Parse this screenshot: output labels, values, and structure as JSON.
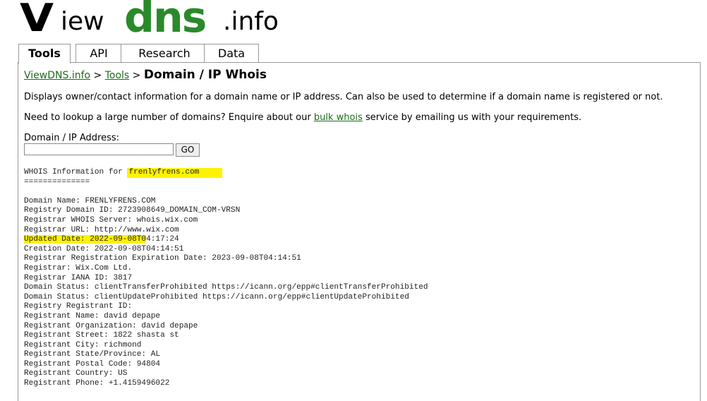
{
  "logo": {
    "v": "V",
    "iew": "iew",
    "dns": "dns",
    "info": ".info"
  },
  "tabs": [
    {
      "label": "Tools",
      "active": true
    },
    {
      "label": "API"
    },
    {
      "label": "Research"
    },
    {
      "label": "Data"
    }
  ],
  "breadcrumb": {
    "home": "ViewDNS.info",
    "sep1": " > ",
    "tools": "Tools",
    "sep2": " > ",
    "title": "Domain / IP Whois"
  },
  "description": {
    "line1": "Displays owner/contact information for a domain name or IP address. Can also be used to determine if a domain name is registered or not.",
    "line2_pre": "Need to lookup a large number of domains? Enquire about our ",
    "line2_link": "bulk whois",
    "line2_post": " service by emailing us with your requirements."
  },
  "form": {
    "label": "Domain / IP Address:",
    "value": "",
    "button": "GO"
  },
  "whois": {
    "header_prefix": "WHOIS Information for ",
    "header_domain": "frenlyfrens.com",
    "underline": "==============",
    "updated_highlight": "Updated Date: 2022-09-08T0",
    "updated_rest": "4:17:24",
    "lines": [
      "Domain Name: FRENLYFRENS.COM",
      "Registry Domain ID: 2723908649_DOMAIN_COM-VRSN",
      "Registrar WHOIS Server: whois.wix.com",
      "Registrar URL: http://www.wix.com"
    ],
    "lines_after": [
      "Creation Date: 2022-09-08T04:14:51",
      "Registrar Registration Expiration Date: 2023-09-08T04:14:51",
      "Registrar: Wix.Com Ltd.",
      "Registrar IANA ID: 3817",
      "Domain Status: clientTransferProhibited https://icann.org/epp#clientTransferProhibited",
      "Domain Status: clientUpdateProhibited https://icann.org/epp#clientUpdateProhibited",
      "Registry Registrant ID:",
      "Registrant Name: david depape",
      "Registrant Organization: david depape",
      "Registrant Street: 1822 shasta st",
      "Registrant City: richmond",
      "Registrant State/Province: AL",
      "Registrant Postal Code: 94804",
      "Registrant Country: US",
      "Registrant Phone: +1.4159496022"
    ]
  }
}
